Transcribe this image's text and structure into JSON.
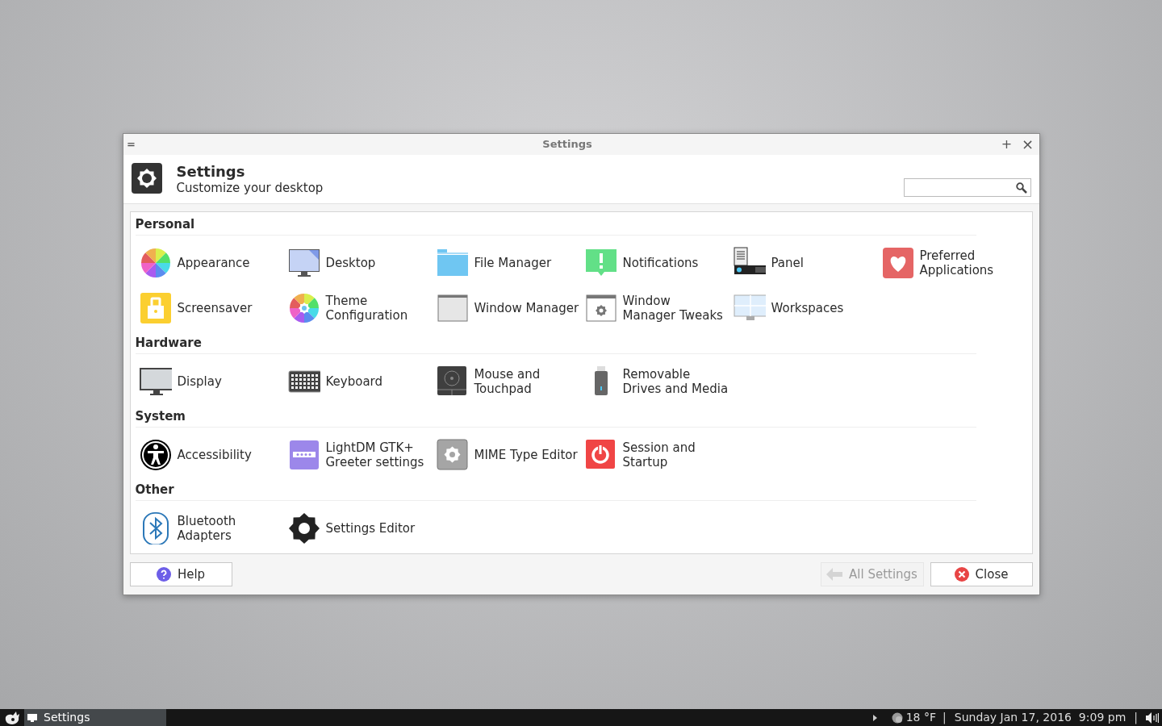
{
  "window": {
    "menu_glyph": "=",
    "title": "Settings",
    "maximize_glyph": "+",
    "close_glyph": "×"
  },
  "header": {
    "title": "Settings",
    "subtitle": "Customize your desktop"
  },
  "sections": [
    {
      "title": "Personal",
      "items": [
        {
          "label": "Appearance"
        },
        {
          "label": "Desktop"
        },
        {
          "label": "File Manager"
        },
        {
          "label": "Notifications"
        },
        {
          "label": "Panel"
        },
        {
          "label": "Preferred\nApplications"
        },
        {
          "label": "Screensaver"
        },
        {
          "label": "Theme\nConfiguration"
        },
        {
          "label": "Window Manager"
        },
        {
          "label": "Window\nManager Tweaks"
        },
        {
          "label": "Workspaces"
        }
      ]
    },
    {
      "title": "Hardware",
      "items": [
        {
          "label": "Display"
        },
        {
          "label": "Keyboard"
        },
        {
          "label": "Mouse and\nTouchpad"
        },
        {
          "label": "Removable\nDrives and Media"
        }
      ]
    },
    {
      "title": "System",
      "items": [
        {
          "label": "Accessibility"
        },
        {
          "label": "LightDM GTK+\nGreeter settings"
        },
        {
          "label": "MIME Type Editor"
        },
        {
          "label": "Session and\nStartup"
        }
      ]
    },
    {
      "title": "Other",
      "items": [
        {
          "label": "Bluetooth\nAdapters"
        },
        {
          "label": "Settings Editor"
        }
      ]
    }
  ],
  "buttons": [
    {
      "kind": "help",
      "label": "Help",
      "disabled": false
    },
    {
      "kind": "back",
      "label": "All Settings",
      "disabled": true
    },
    {
      "kind": "close",
      "label": "Close",
      "disabled": false
    }
  ],
  "taskbar": {
    "tasks": [
      {
        "label": "Settings",
        "selected": true
      }
    ],
    "tray": [
      {
        "kind": "weather",
        "text": "18 °F"
      },
      {
        "kind": "sep",
        "text": "|"
      },
      {
        "kind": "clock",
        "text": "Sunday Jan 17, 2016  9:09 pm"
      },
      {
        "kind": "sep",
        "text": "|"
      },
      {
        "kind": "volume"
      }
    ]
  }
}
